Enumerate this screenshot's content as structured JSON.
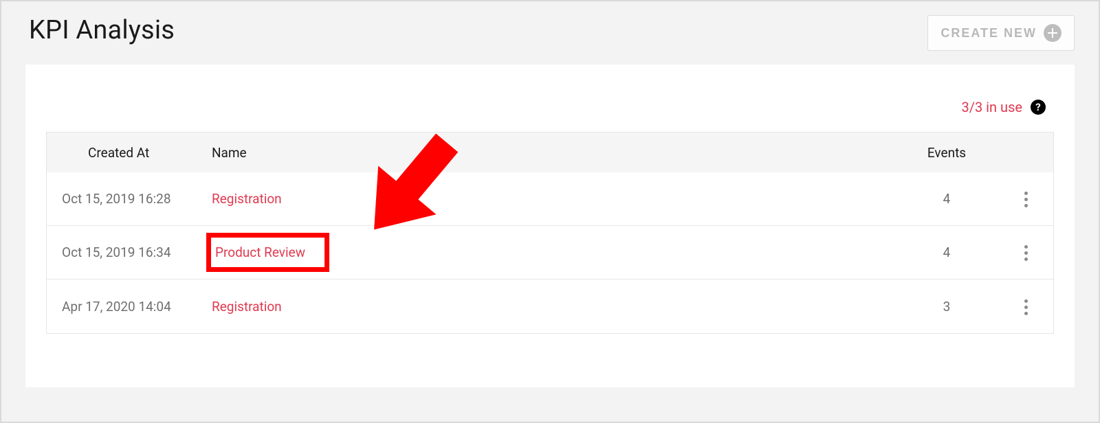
{
  "header": {
    "title": "KPI Analysis",
    "create_button": "CREATE NEW"
  },
  "usage": {
    "text": "3/3 in use"
  },
  "table": {
    "columns": {
      "created_at": "Created At",
      "name": "Name",
      "events": "Events"
    },
    "rows": [
      {
        "created_at": "Oct 15, 2019 16:28",
        "name": "Registration",
        "events": "4",
        "highlighted": false
      },
      {
        "created_at": "Oct 15, 2019 16:34",
        "name": "Product Review",
        "events": "4",
        "highlighted": true
      },
      {
        "created_at": "Apr 17, 2020 14:04",
        "name": "Registration",
        "events": "3",
        "highlighted": false
      }
    ]
  }
}
